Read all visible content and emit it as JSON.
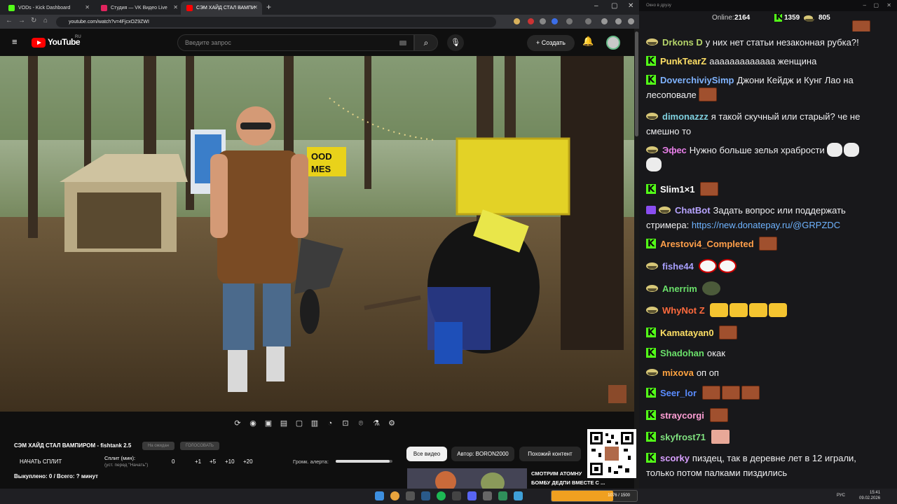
{
  "browser": {
    "tabs": [
      {
        "label": "VODs - Kick Dashboard",
        "color": "#53fc18"
      },
      {
        "label": "Студия — VK Видео Live",
        "color": "#e0245e"
      },
      {
        "label": "СЭМ ХАЙД СТАЛ ВАМПИ",
        "color": "#ff0000"
      }
    ],
    "url": "youtube.com/watch?v=4FjcxOZ9ZWI"
  },
  "youtube": {
    "logo_text": "YouTube",
    "region": "RU",
    "search_placeholder": "Введите запрос",
    "create_label": "Создать"
  },
  "panel": {
    "title": "СЭМ ХАЙД СТАЛ ВАМПИРОМ - fishtank 2.5",
    "btn_wait": "На ожидан",
    "btn_vote": "ГОЛОСОВАТЬ",
    "start_split": "НАЧАТЬ СПЛИТ",
    "split_label": "Сплит (мин):",
    "split_hint": "(уст. перед \"Начать\")",
    "split_values": [
      "0",
      "+1",
      "+5",
      "+10",
      "+20"
    ],
    "alert_volume_label": "Громк. алерта:",
    "alert_volume_level": 0.95,
    "bought": "Выкуплено: 0 / Всего: ? минут",
    "chips": [
      "Все видео",
      "Автор: BORON2000",
      "Похожий контент"
    ],
    "related_title_1": "СМОТРИМ АТОМНУ",
    "related_title_2": "БОМБУ ДЕДПИ ВМЕСТЕ С ..."
  },
  "chat": {
    "window_title": "Окно в друзу",
    "online_label": "Online:",
    "online_count": "2164",
    "kick_count": "1359",
    "vk_count": "805",
    "messages": [
      {
        "platform": "vk",
        "nick": "Drkons D",
        "color": "#b5d46a",
        "text": "у них нет статьи незаконная рубка?!"
      },
      {
        "platform": "kick",
        "nick": "PunkTearZ",
        "color": "#ffe066",
        "text": "ааааааааааааа женщина"
      },
      {
        "platform": "kick",
        "nick": "DoverchiviySimp",
        "color": "#7fb3ff",
        "text": "Джони Кейдж и Кунг Лао на",
        "text2": "лесоповале"
      },
      {
        "platform": "vk",
        "nick": "dimonazzz",
        "color": "#7fd1e0",
        "text": "я такой скучный или старый? че не",
        "text2": "смешно то"
      },
      {
        "platform": "vk",
        "nick": "Эфес",
        "color": "#e87fe8",
        "text": "Нужно больше зелья храбрости"
      },
      {
        "platform": "kick",
        "nick": "Slim1×1",
        "color": "#ffffff",
        "text": ""
      },
      {
        "platform": "bot",
        "nick": "ChatBot",
        "color": "#b7a4ff",
        "text": "Задать вопрос или поддержать",
        "text2": "стримера:",
        "link": "https://new.donatepay.ru/@GRPZDC"
      },
      {
        "platform": "kick",
        "nick": "Arestovi4_Completed",
        "color": "#ff9f4a",
        "text": ""
      },
      {
        "platform": "vk",
        "nick": "fishe44",
        "color": "#a9a0ff",
        "text": ""
      },
      {
        "platform": "vk",
        "nick": "Anerrim",
        "color": "#6ae06a",
        "text": ""
      },
      {
        "platform": "vk",
        "nick": "WhyNot Z",
        "color": "#ff6a3d",
        "text": ""
      },
      {
        "platform": "kick",
        "nick": "Kamatayan0",
        "color": "#ffe066",
        "text": ""
      },
      {
        "platform": "kick",
        "nick": "Shadohan",
        "color": "#6ae06a",
        "text": "окак"
      },
      {
        "platform": "vk",
        "nick": "mixova",
        "color": "#ffa340",
        "text": "оп оп"
      },
      {
        "platform": "kick",
        "nick": "Seer_lor",
        "color": "#5a8cff",
        "text": ""
      },
      {
        "platform": "kick",
        "nick": "straycorgi",
        "color": "#ff9fd6",
        "text": ""
      },
      {
        "platform": "kick",
        "nick": "skyfrost71",
        "color": "#7fe07f",
        "text": ""
      },
      {
        "platform": "kick",
        "nick": "scorky",
        "color": "#d8a0ff",
        "text": "пиздец, так в деревне лет в 12 играли,",
        "text2": "только потом палками пиздились"
      }
    ]
  },
  "taskbar": {
    "donate_progress": "1076 / 1500",
    "donate_fraction": 0.72,
    "lang": "РУС",
    "time": "15:41",
    "date": "09.02.2026"
  }
}
